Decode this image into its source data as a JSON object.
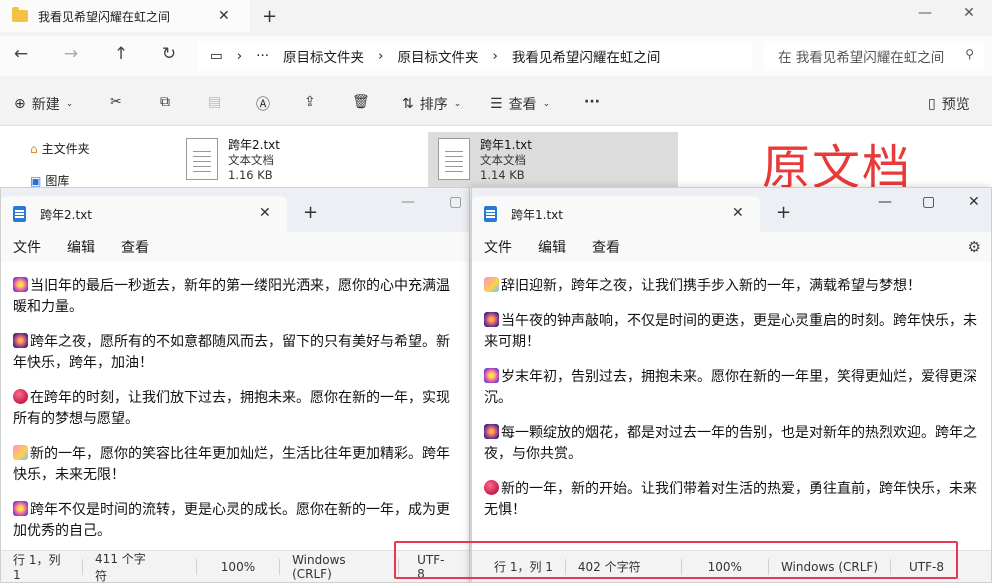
{
  "explorer": {
    "tab_title": "我看见希望闪耀在虹之间",
    "breadcrumb": [
      "原目标文件夹",
      "原目标文件夹",
      "我看见希望闪耀在虹之间"
    ],
    "search_placeholder": "在 我看见希望闪耀在虹之间",
    "toolbar": {
      "new": "新建",
      "sort": "排序",
      "view": "查看",
      "more": "···",
      "preview": "预览"
    },
    "sidebar": [
      {
        "label": "主文件夹"
      },
      {
        "label": "图库"
      }
    ],
    "files": [
      {
        "name": "跨年2.txt",
        "type": "文本文档",
        "size": "1.16 KB"
      },
      {
        "name": "跨年1.txt",
        "type": "文本文档",
        "size": "1.14 KB"
      }
    ]
  },
  "annotation_label": "原文档",
  "notepad_left": {
    "tab_title": "跨年2.txt",
    "menu": [
      "文件",
      "编辑",
      "查看"
    ],
    "paragraphs": [
      "当旧年的最后一秒逝去，新年的第一缕阳光洒来，愿你的心中充满温暖和力量。",
      "跨年之夜，愿所有的不如意都随风而去，留下的只有美好与希望。新年快乐，跨年，加油！",
      "在跨年的时刻，让我们放下过去，拥抱未来。愿你在新的一年，实现所有的梦想与愿望。",
      "新的一年，愿你的笑容比往年更加灿烂，生活比往年更加精彩。跨年快乐，未来无限！",
      "跨年不仅是时间的流转，更是心灵的成长。愿你在新的一年，成为更加优秀的自己。"
    ],
    "status": {
      "pos": "行 1，列 1",
      "chars": "411 个字符",
      "zoom": "100%",
      "eol": "Windows (CRLF)",
      "enc": "UTF-8"
    }
  },
  "notepad_right": {
    "tab_title": "跨年1.txt",
    "menu": [
      "文件",
      "编辑",
      "查看"
    ],
    "paragraphs": [
      "辞旧迎新，跨年之夜，让我们携手步入新的一年，满载希望与梦想！",
      "当午夜的钟声敲响，不仅是时间的更迭，更是心灵重启的时刻。跨年快乐，未来可期！",
      "岁末年初，告别过去，拥抱未来。愿你在新的一年里，笑得更灿烂，爱得更深沉。",
      "每一颗绽放的烟花，都是对过去一年的告别，也是对新年的热烈欢迎。跨年之夜，与你共赏。",
      "新的一年，新的开始。让我们带着对生活的热爱，勇往直前，跨年快乐，未来无惧！"
    ],
    "status": {
      "pos": "行 1，列 1",
      "chars": "402 个字符",
      "zoom": "100%",
      "eol": "Windows (CRLF)",
      "enc": "UTF-8"
    }
  }
}
